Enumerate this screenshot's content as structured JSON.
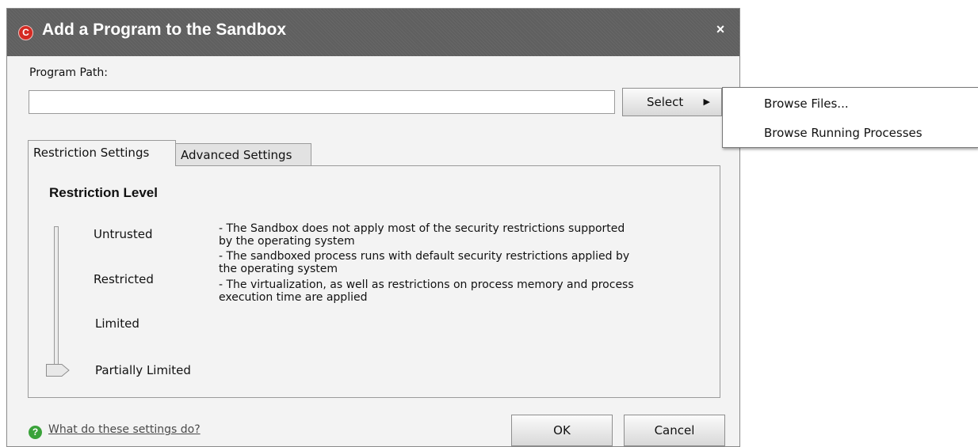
{
  "window": {
    "title": "Add a Program to the Sandbox",
    "app_icon_letter": "C",
    "close_glyph": "×"
  },
  "program_path": {
    "label": "Program Path:",
    "value": "",
    "placeholder": ""
  },
  "select_button": {
    "label": "Select",
    "arrow": "▶"
  },
  "tabs": [
    {
      "label": "Restriction Settings",
      "active": true
    },
    {
      "label": "Advanced Settings",
      "active": false
    }
  ],
  "restriction": {
    "heading": "Restriction Level",
    "levels": [
      "Untrusted",
      "Restricted",
      "Limited",
      "Partially Limited"
    ],
    "selected_level": "Partially Limited",
    "descriptions": [
      [
        "- The Sandbox does not apply most of the security restrictions supported",
        "by the operating system"
      ],
      [
        "- The sandboxed process runs with default security restrictions applied by",
        "the operating system"
      ],
      [
        "- The virtualization, as well as restrictions on process memory and process",
        "execution time are applied"
      ]
    ]
  },
  "help": {
    "icon": "?",
    "link_text": "What do these settings do?"
  },
  "buttons": {
    "ok": "OK",
    "cancel": "Cancel"
  },
  "context_menu": {
    "items": [
      "Browse Files...",
      "Browse Running Processes"
    ]
  },
  "colors": {
    "titlebar": "#5f5f5f",
    "app_icon": "#d42a22",
    "help_icon": "#3aa23a"
  }
}
